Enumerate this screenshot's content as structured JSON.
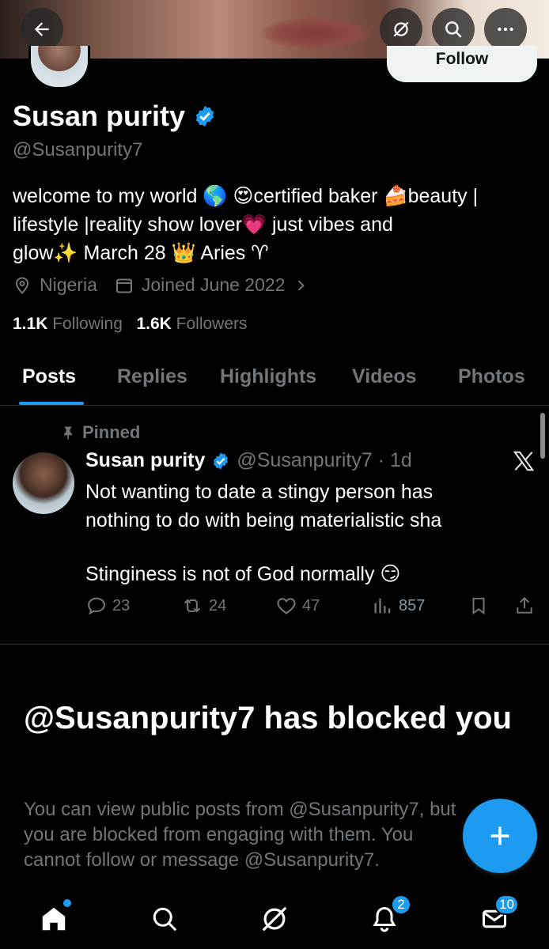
{
  "header": {
    "follow_label": "Follow",
    "icons": [
      "back-arrow-icon",
      "grok-icon",
      "search-icon",
      "more-icon"
    ]
  },
  "profile": {
    "name": "Susan purity",
    "handle": "@Susanpurity7",
    "bio_line1": "welcome to my world 🌎  😍certified baker 🍰beauty |",
    "bio_line2": "lifestyle |reality show lover💗  just vibes and",
    "bio_line3": "glow✨ March 28 👑  Aries ♈",
    "location": "Nigeria",
    "joined": "Joined June 2022",
    "following_count": "1.1K",
    "following_label": "Following",
    "followers_count": "1.6K",
    "followers_label": "Followers"
  },
  "tabs": [
    "Posts",
    "Replies",
    "Highlights",
    "Videos",
    "Photos"
  ],
  "active_tab": "Posts",
  "pinned_post": {
    "pinned_label": "Pinned",
    "author": "Susan purity",
    "handle_time": "@Susanpurity7 · 1d",
    "text_line1": "Not wanting to date a stingy person has",
    "text_line2": "nothing to do with being materialistic sha",
    "text_line3": "Stinginess is not of God normally 😏",
    "replies": "23",
    "reposts": "24",
    "likes": "47",
    "views": "857"
  },
  "blocked": {
    "title": "@Susanpurity7 has blocked you",
    "desc_line1": "You can view public posts from @Susanpurity7, but",
    "desc_line2": "you are blocked from engaging with them. You",
    "desc_line3": "cannot follow or message @Susanpurity7."
  },
  "bottom_nav": {
    "notifications_badge": "2",
    "messages_badge": "10"
  },
  "colors": {
    "accent": "#1d9bf0",
    "muted": "#71767b",
    "background": "#000000"
  }
}
